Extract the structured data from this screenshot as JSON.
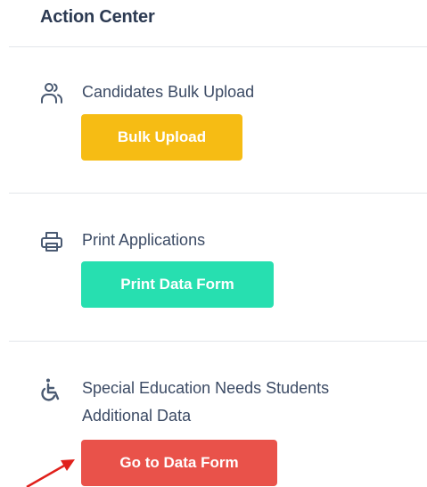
{
  "panel": {
    "title": "Action Center"
  },
  "sections": [
    {
      "icon": "users-icon",
      "label": "Candidates Bulk Upload",
      "button_label": "Bulk Upload",
      "button_color": "#f6bc14"
    },
    {
      "icon": "printer-icon",
      "label": "Print Applications",
      "button_label": "Print Data Form",
      "button_color": "#27dfb0"
    },
    {
      "icon": "wheelchair-icon",
      "label": "Special Education Needs Students Additional Data",
      "button_label": "Go to Data Form",
      "button_color": "#e9524a"
    }
  ],
  "annotation": {
    "arrow_color": "#e0201b"
  }
}
